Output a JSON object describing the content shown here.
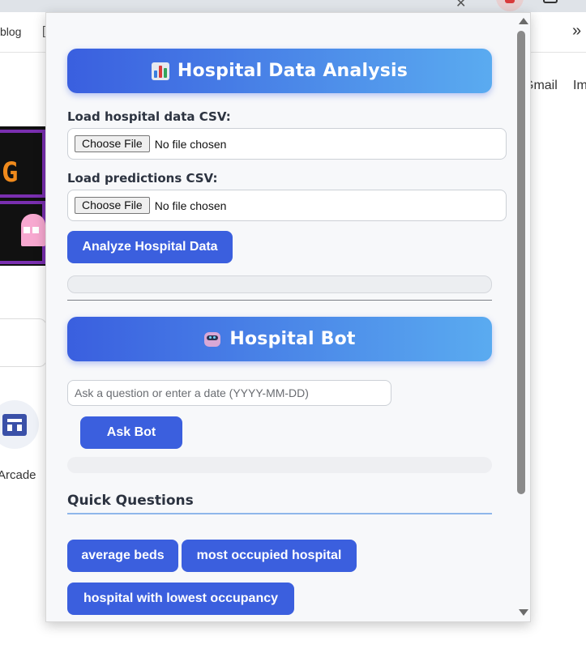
{
  "background": {
    "bookmark_text": "blog",
    "bookmark_bracket": "[",
    "overflow_chevrons": "»",
    "gmail_link": "Gmail",
    "images_link": "Im",
    "arcade_label": "Arcade",
    "game_letter": "G"
  },
  "popup": {
    "analysis": {
      "title": "Hospital Data Analysis",
      "icon": "bar-chart-icon",
      "hospital_data_label": "Load hospital data CSV:",
      "predictions_label": "Load predictions CSV:",
      "file_button": "Choose File",
      "file_status": "No file chosen",
      "analyze_button": "Analyze Hospital Data"
    },
    "bot": {
      "title": "Hospital Bot",
      "icon": "robot-icon",
      "input_placeholder": "Ask a question or enter a date (YYYY-MM-DD)",
      "ask_button": "Ask Bot"
    },
    "quick_questions": {
      "heading": "Quick Questions",
      "items": [
        "average beds",
        "most occupied hospital",
        "hospital with lowest occupancy"
      ]
    }
  },
  "colors": {
    "primary": "#3b5fde",
    "banner_gradient_start": "#3a5fdf",
    "banner_gradient_end": "#5aabf0",
    "popup_background": "#f7f8fa"
  }
}
